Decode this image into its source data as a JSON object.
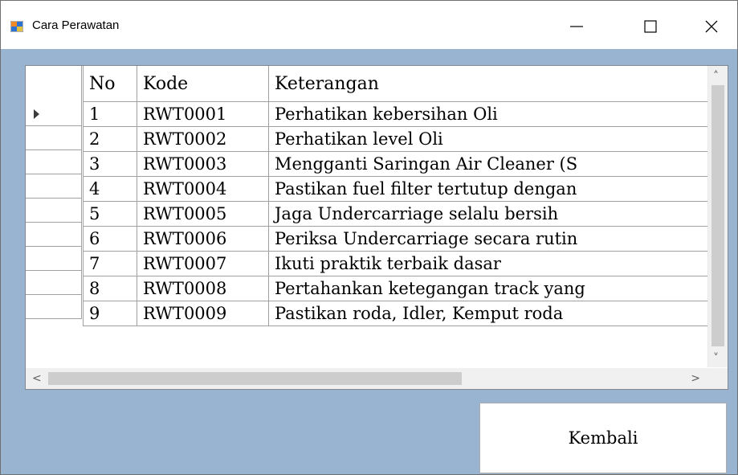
{
  "window": {
    "title": "Cara Perawatan"
  },
  "grid": {
    "columns": [
      "No",
      "Kode",
      "Keterangan"
    ],
    "rows": [
      {
        "no": "1",
        "kode": "RWT0001",
        "keterangan": "Perhatikan kebersihan Oli"
      },
      {
        "no": "2",
        "kode": "RWT0002",
        "keterangan": "Perhatikan level Oli"
      },
      {
        "no": "3",
        "kode": "RWT0003",
        "keterangan": "Mengganti Saringan Air Cleaner (S"
      },
      {
        "no": "4",
        "kode": "RWT0004",
        "keterangan": "Pastikan fuel filter tertutup dengan"
      },
      {
        "no": "5",
        "kode": "RWT0005",
        "keterangan": "Jaga Undercarriage selalu bersih"
      },
      {
        "no": "6",
        "kode": "RWT0006",
        "keterangan": "Periksa Undercarriage secara rutin"
      },
      {
        "no": "7",
        "kode": "RWT0007",
        "keterangan": "Ikuti praktik terbaik dasar"
      },
      {
        "no": "8",
        "kode": "RWT0008",
        "keterangan": "Pertahankan ketegangan track yang"
      },
      {
        "no": "9",
        "kode": "RWT0009",
        "keterangan": "Pastikan roda, Idler, Kemput roda"
      }
    ],
    "selected_row": "1"
  },
  "buttons": {
    "kembali": "Kembali"
  },
  "icons": {
    "minimize": "minimize-icon",
    "maximize": "maximize-icon",
    "close": "close-icon",
    "app": "form-icon"
  }
}
